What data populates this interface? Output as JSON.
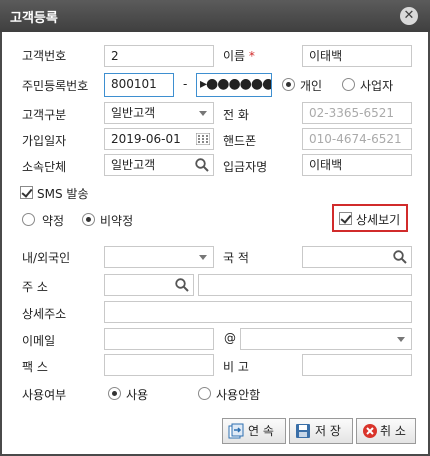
{
  "window": {
    "title": "고객등록"
  },
  "fields": {
    "customer_no": {
      "label": "고객번호",
      "value": "2"
    },
    "name": {
      "label": "이름",
      "required_mark": "*",
      "value": "이태백"
    },
    "resident_no": {
      "label": "주민등록번호",
      "front": "800101",
      "separator": "-",
      "back_masked": "▸●●●●●●"
    },
    "customer_type": {
      "label": "고객구분",
      "value": "일반고객"
    },
    "phone": {
      "label": "전 화",
      "value": "02-3365-6521"
    },
    "join_date": {
      "label": "가입일자",
      "value": "2019-06-01"
    },
    "mobile": {
      "label": "핸드폰",
      "value": "010-4674-6521"
    },
    "group": {
      "label": "소속단체",
      "value": "일반고객"
    },
    "depositor": {
      "label": "입금자명",
      "value": "이태백"
    },
    "domestic": {
      "label": "내/외국인",
      "value": ""
    },
    "nationality": {
      "label": "국 적",
      "value": ""
    },
    "address": {
      "label": "주 소",
      "zip": "",
      "value": ""
    },
    "address_detail": {
      "label": "상세주소",
      "value": ""
    },
    "email": {
      "label": "이메일",
      "at": "@",
      "user": "",
      "domain": ""
    },
    "fax": {
      "label": "팩 스",
      "value": ""
    },
    "memo": {
      "label": "비 고",
      "value": ""
    },
    "use": {
      "label": "사용여부"
    }
  },
  "person_type": {
    "options": [
      "개인",
      "사업자"
    ],
    "selected": "개인"
  },
  "sms": {
    "label": "SMS 발송",
    "checked": true
  },
  "contract": {
    "options": [
      "약정",
      "비약정"
    ],
    "selected": "비약정"
  },
  "detail_view": {
    "label": "상세보기",
    "checked": true
  },
  "use_options": {
    "options": [
      "사용",
      "사용안함"
    ],
    "selected": "사용"
  },
  "buttons": {
    "continue": "연 속",
    "save": "저 장",
    "cancel": "취 소"
  }
}
